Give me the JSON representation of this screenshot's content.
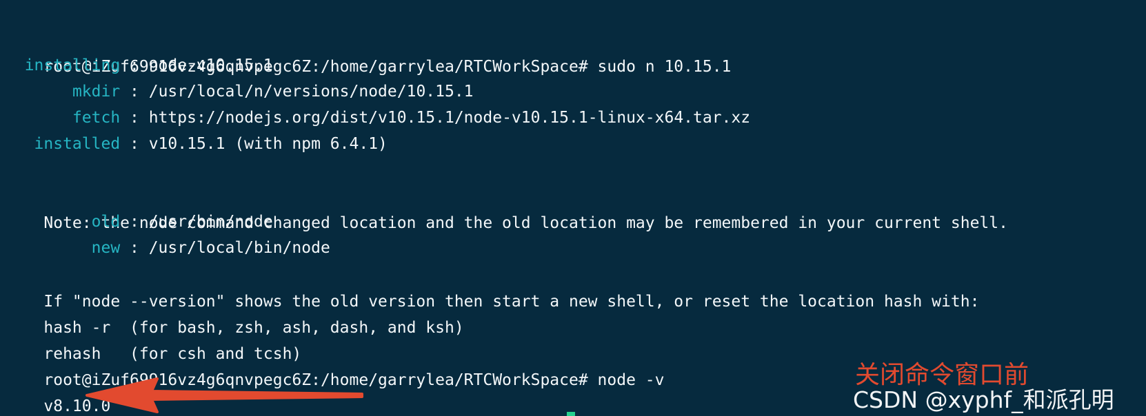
{
  "terminal": {
    "lines": [
      {
        "plain_a": "root@iZuf69916vz4g6qnvpegc6Z:/home/garrylea/RTCWorkSpace# sudo n 10.15.1"
      },
      {
        "indent": "  ",
        "key": "installing",
        "rest": " : node-v10.15.1"
      },
      {
        "indent": "       ",
        "key": "mkdir",
        "rest": " : /usr/local/n/versions/node/10.15.1"
      },
      {
        "indent": "       ",
        "key": "fetch",
        "rest": " : https://nodejs.org/dist/v10.15.1/node-v10.15.1-linux-x64.tar.xz"
      },
      {
        "indent": "   ",
        "key": "installed",
        "rest": " : v10.15.1 (with npm 6.4.1)"
      },
      {
        "plain_a": ""
      },
      {
        "plain_a": "Note: the node command changed location and the old location may be remembered in your current shell."
      },
      {
        "indent": "         ",
        "key": "old",
        "rest": " : /usr/bin/node"
      },
      {
        "indent": "         ",
        "key": "new",
        "rest": " : /usr/local/bin/node"
      },
      {
        "plain_a": "If \"node --version\" shows the old version then start a new shell, or reset the location hash with:"
      },
      {
        "plain_a": "hash -r  (for bash, zsh, ash, dash, and ksh)"
      },
      {
        "plain_a": "rehash   (for csh and tcsh)"
      },
      {
        "plain_a": "root@iZuf69916vz4g6qnvpegc6Z:/home/garrylea/RTCWorkSpace# node -v"
      },
      {
        "plain_a": "v8.10.0"
      }
    ],
    "background": "#062a3e",
    "text_color": "#f3f7f9",
    "key_color": "#26b5c3",
    "cursor_color": "#24d08d"
  },
  "annotation": {
    "text": "关闭命令窗口前",
    "color": "#e24a2f",
    "arrow_icon": "left-arrow-icon"
  },
  "watermark": {
    "text": "CSDN @xyphf_和派孔明"
  }
}
